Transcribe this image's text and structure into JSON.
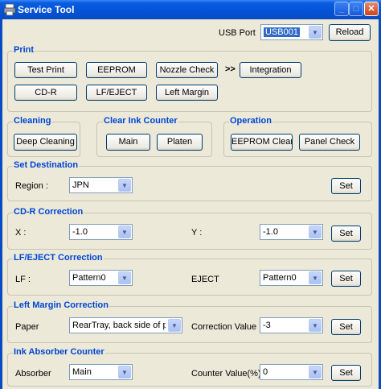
{
  "window": {
    "title": "Service Tool",
    "minimize_label": "_",
    "maximize_label": "□",
    "close_label": "✕"
  },
  "usb": {
    "label": "USB Port",
    "value": "USB001",
    "reload": "Reload"
  },
  "print": {
    "title": "Print",
    "test_print": "Test Print",
    "eeprom": "EEPROM",
    "nozzle_check": "Nozzle Check",
    "chevrons": ">>",
    "integration": "Integration",
    "cdr": "CD-R",
    "lf_eject": "LF/EJECT",
    "left_margin": "Left Margin"
  },
  "cleaning": {
    "title": "Cleaning",
    "deep_cleaning": "Deep Cleaning"
  },
  "ink_counter": {
    "title": "Clear Ink Counter",
    "main": "Main",
    "platen": "Platen"
  },
  "operation": {
    "title": "Operation",
    "eeprom_clear": "EEPROM Clear",
    "panel_check": "Panel Check"
  },
  "destination": {
    "title": "Set Destination",
    "region_label": "Region :",
    "region_value": "JPN",
    "set": "Set"
  },
  "cdr_correction": {
    "title": "CD-R Correction",
    "x_label": "X :",
    "x_value": "-1.0",
    "y_label": "Y :",
    "y_value": "-1.0",
    "set": "Set"
  },
  "lf_correction": {
    "title": "LF/EJECT Correction",
    "lf_label": "LF :",
    "lf_value": "Pattern0",
    "eject_label": "EJECT",
    "eject_value": "Pattern0",
    "set": "Set"
  },
  "margin_correction": {
    "title": "Left Margin Correction",
    "paper_label": "Paper",
    "paper_value": "RearTray, back side of p",
    "corr_label": "Correction Value",
    "corr_value": "-3",
    "set": "Set"
  },
  "absorber_counter": {
    "title": "Ink Absorber Counter",
    "absorber_label": "Absorber",
    "absorber_value": "Main",
    "counter_label": "Counter Value(%)",
    "counter_value": "0",
    "set": "Set"
  },
  "icons": {
    "dropdown": "chevron-down-icon",
    "app": "printer-icon"
  },
  "colors": {
    "titlebar": "#0453d6",
    "group_label": "#0046d5",
    "window_bg": "#ece9d8",
    "selection": "#316ac5"
  }
}
